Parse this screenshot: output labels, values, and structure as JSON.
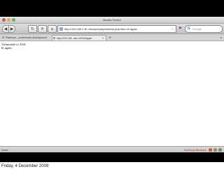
{
  "window": {
    "title": "Mozilla Firefox"
  },
  "toolbar": {
    "back_glyph": "◀",
    "forward_glyph": "▶",
    "reload_glyph": "↻",
    "stop_glyph": "✕",
    "home_glyph": "⌂",
    "go_glyph": "▶",
    "url": "http://192.168.1.8/~ebcoyne/phptest/xss.php?abc=hi again",
    "search_placeholder": "Google"
  },
  "tabs": [
    {
      "label": "Platforms – preferences development"
    },
    {
      "label": "http://192.168...abc=hi%20again"
    }
  ],
  "tab_controls": {
    "add_glyph": "+",
    "close_glyph": "×",
    "scroll_glyph": "▸"
  },
  "content": {
    "lines": [
      "Vulnerable to XSS",
      "hi again"
    ]
  },
  "status": {
    "text": "Done",
    "addon": "NoScript Blocked"
  },
  "footer": {
    "date": "Friday, 4 December 2009"
  },
  "colors": {
    "background": "#ffffff",
    "chrome": "#c9c9c9",
    "frame": "#000000"
  }
}
